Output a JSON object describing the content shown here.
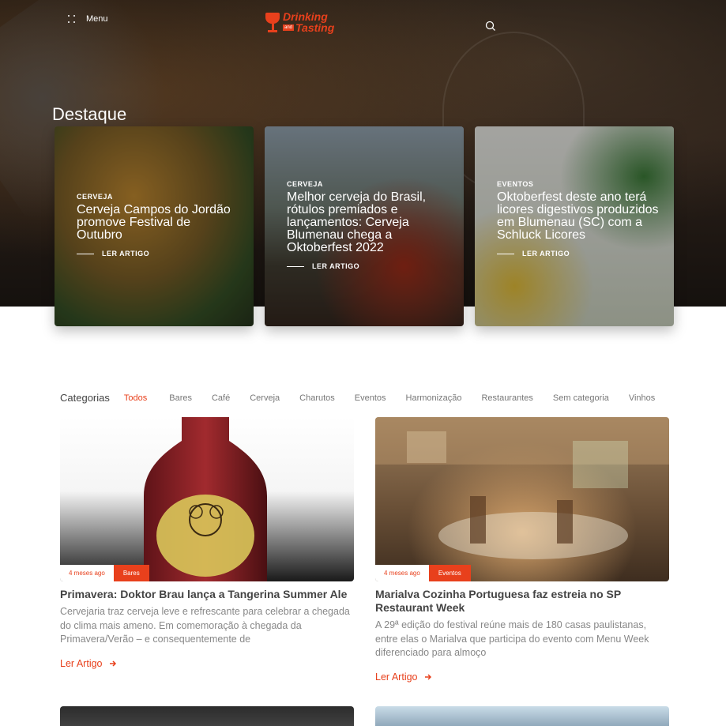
{
  "header": {
    "menu_label": "Menu",
    "logo": {
      "line1": "Drinking",
      "and": "and",
      "line2": "Tasting"
    }
  },
  "hero": {
    "title": "Destaque",
    "cards": [
      {
        "category": "CERVEJA",
        "title": "Cerveja Campos do Jordão promove Festival de Outubro",
        "read_more": "LER ARTIGO"
      },
      {
        "category": "CERVEJA",
        "title": "Melhor cerveja do Brasil, rótulos premiados e lançamentos: Cerveja Blumenau chega a Oktoberfest 2022",
        "read_more": "LER ARTIGO"
      },
      {
        "category": "EVENTOS",
        "title": "Oktoberfest deste ano terá licores digestivos produzidos em Blumenau (SC) com a Schluck Licores",
        "read_more": "LER ARTIGO"
      }
    ]
  },
  "categories": {
    "label": "Categorias",
    "items": [
      "Todos",
      "Bares",
      "Café",
      "Cerveja",
      "Charutos",
      "Eventos",
      "Harmonização",
      "Restaurantes",
      "Sem categoria",
      "Vinhos"
    ],
    "active": "Todos"
  },
  "posts": [
    {
      "time": "4 meses ago",
      "category": "Bares",
      "title": "Primavera: Doktor Brau lança a Tangerina Summer Ale",
      "excerpt": "Cervejaria traz cerveja leve e refrescante para celebrar a chegada do clima mais ameno. Em comemoração à chegada da Primavera/Verão – e consequentemente de",
      "read_more": "Ler Artigo"
    },
    {
      "time": "4 meses ago",
      "category": "Eventos",
      "title": "Marialva Cozinha Portuguesa faz estreia no SP Restaurant Week",
      "excerpt": "A 29ª edição do festival reúne mais de 180 casas paulistanas, entre elas o Marialva que participa do evento com Menu Week diferenciado para almoço",
      "read_more": "Ler Artigo"
    }
  ],
  "colors": {
    "accent": "#e8401c",
    "text": "#444444",
    "muted": "#888888"
  },
  "icons": [
    "grid-dots-icon",
    "search-icon",
    "arrow-right-icon"
  ]
}
